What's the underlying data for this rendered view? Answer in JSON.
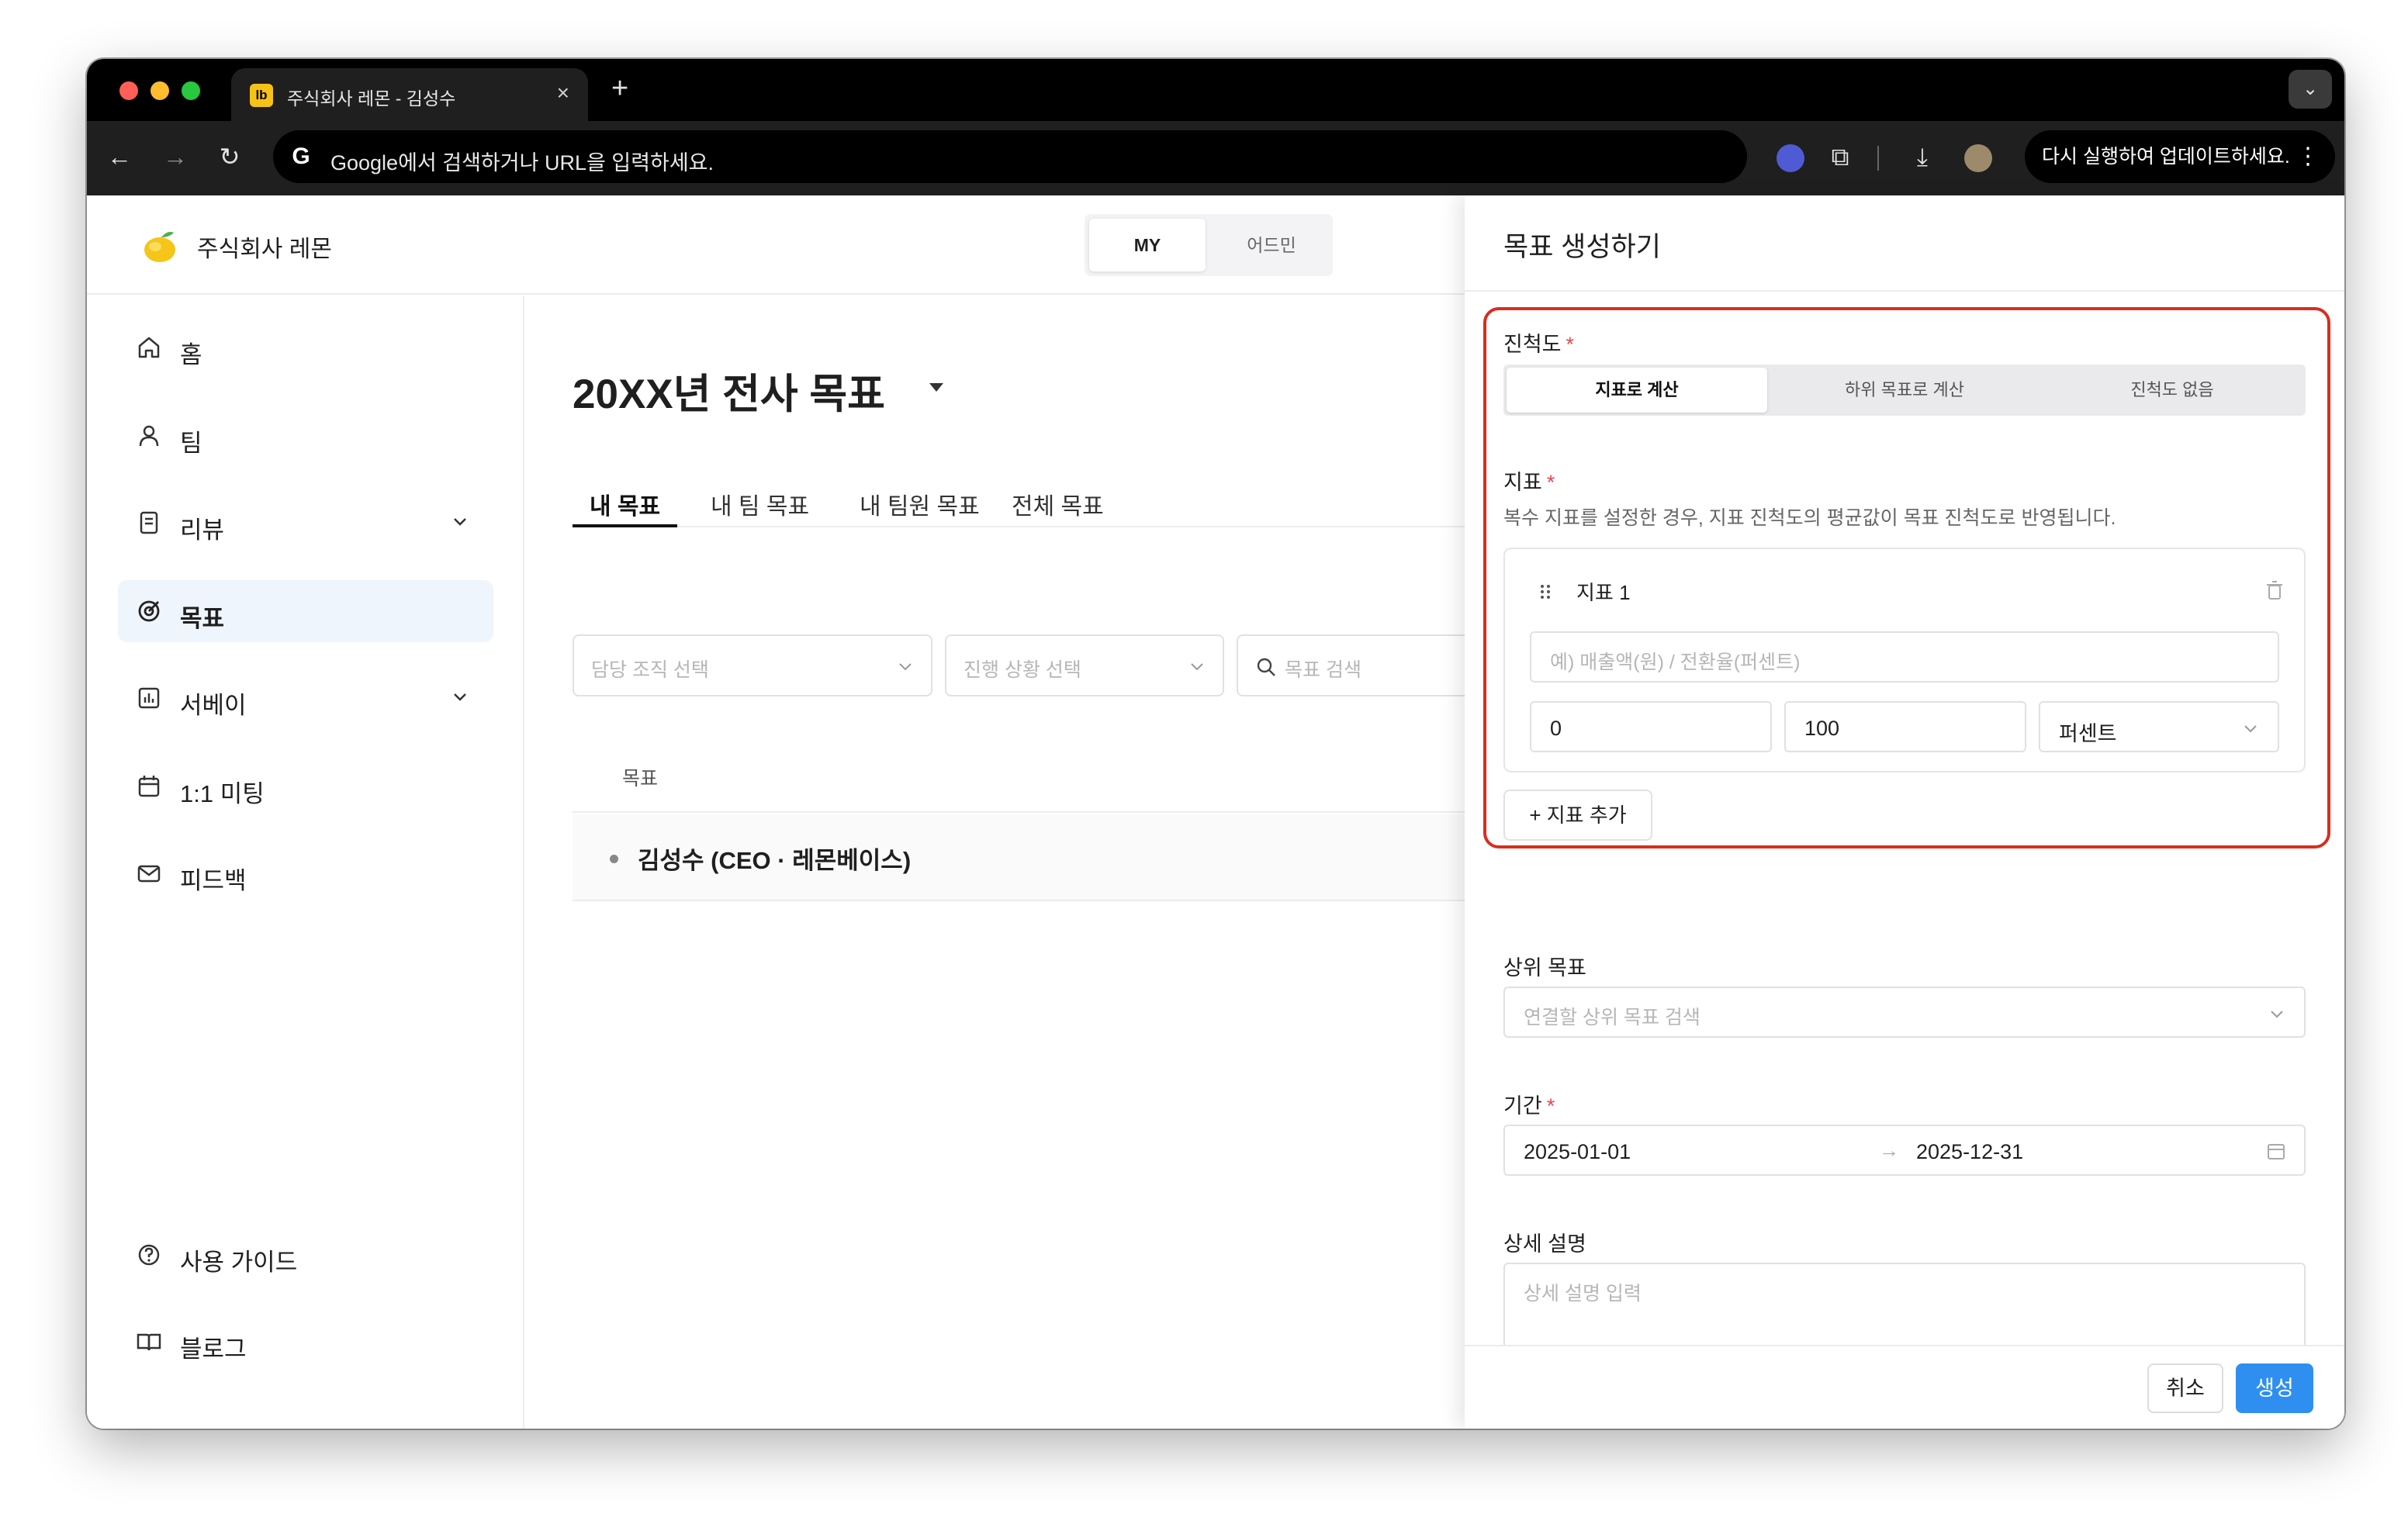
{
  "browser": {
    "tab_title": "주식회사 레몬 - 김성수",
    "tab_favicon": "lb",
    "new_tab": "+",
    "close": "×",
    "address_placeholder": "Google에서 검색하거나 URL을 입력하세요.",
    "update_label": "다시 실행하여 업데이트하세요.",
    "colors": {
      "tabstrip": "#000000",
      "toolbar": "#1f1f1f"
    }
  },
  "header": {
    "company": "주식회사 레몬",
    "mode_my": "MY",
    "mode_admin": "어드민"
  },
  "sidebar": {
    "items": [
      {
        "label": "홈",
        "icon": "home-icon"
      },
      {
        "label": "팀",
        "icon": "person-icon"
      },
      {
        "label": "리뷰",
        "icon": "document-icon",
        "expandable": true
      },
      {
        "label": "목표",
        "icon": "target-icon",
        "active": true
      },
      {
        "label": "서베이",
        "icon": "chart-icon",
        "expandable": true
      },
      {
        "label": "1:1 미팅",
        "icon": "calendar-icon"
      },
      {
        "label": "피드백",
        "icon": "mail-icon"
      }
    ],
    "bottom": [
      {
        "label": "사용 가이드",
        "icon": "help-icon"
      },
      {
        "label": "블로그",
        "icon": "book-icon"
      }
    ]
  },
  "main": {
    "title": "20XX년 전사 목표",
    "tabs": [
      "내 목표",
      "내 팀 목표",
      "내 팀원 목표",
      "전체 목표"
    ],
    "active_tab": "내 목표",
    "filters": {
      "org_placeholder": "담당 조직 선택",
      "status_placeholder": "진행 상황 선택",
      "search_placeholder": "목표 검색"
    },
    "column_header": "목표",
    "rows": [
      "김성수 (CEO · 레몬베이스)"
    ]
  },
  "drawer": {
    "title": "목표 생성하기",
    "progress_label": "진척도",
    "required_mark": "*",
    "progress_options": [
      "지표로 계산",
      "하위 목표로 계산",
      "진척도 없음"
    ],
    "progress_selected": "지표로 계산",
    "metric_label": "지표",
    "metric_help": "복수 지표를 설정한 경우, 지표 진척도의 평균값이 목표 진척도로 반영됩니다.",
    "metric_name": "지표 1",
    "metric_placeholder": "예) 매출액(원) / 전환율(퍼센트)",
    "metric_start": "0",
    "metric_target": "100",
    "metric_unit": "퍼센트",
    "add_metric": "+ 지표 추가",
    "parent_label": "상위 목표",
    "parent_placeholder": "연결할 상위 목표 검색",
    "period_label": "기간",
    "period_start": "2025-01-01",
    "period_end": "2025-12-31",
    "period_arrow": "→",
    "desc_label": "상세 설명",
    "desc_placeholder": "상세 설명 입력",
    "cancel": "취소",
    "create": "생성",
    "colors": {
      "highlight": "#d92d20",
      "primary": "#2f8ff0",
      "required": "#e5484d"
    }
  }
}
